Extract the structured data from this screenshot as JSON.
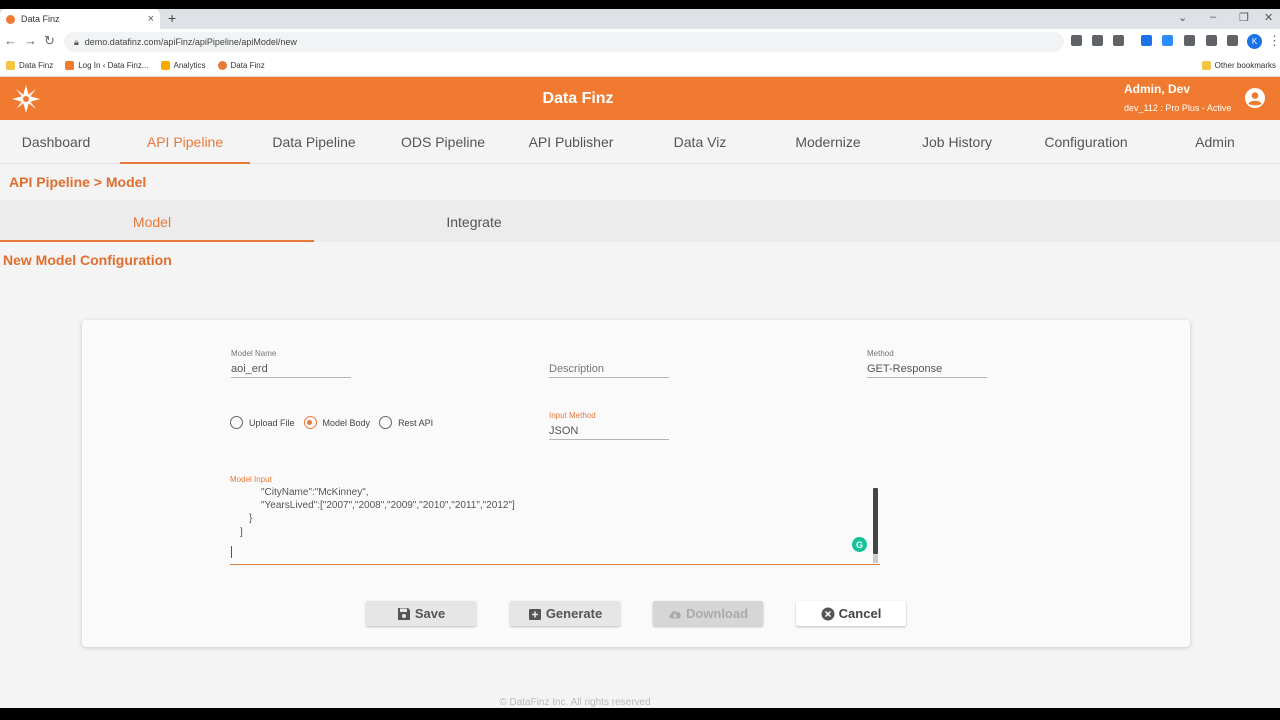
{
  "browser": {
    "tab_title": "Data Finz",
    "url": "demo.datafinz.com/apiFinz/apiPipeline/apiModel/new",
    "profile_initial": "K",
    "bookmarks": [
      {
        "label": "Data Finz",
        "color": "#f4c542"
      },
      {
        "label": "Log In ‹ Data Finz...",
        "color": "#f07a30"
      },
      {
        "label": "Analytics",
        "color": "#f9ab00"
      },
      {
        "label": "Data Finz",
        "color": "#e8793a"
      }
    ],
    "other_bookmarks": "Other bookmarks"
  },
  "header": {
    "title": "Data Finz",
    "user_name": "Admin, Dev",
    "user_role": "dev_112 : Pro Plus - Active",
    "brand_color": "#f07a30"
  },
  "nav": {
    "items": [
      "Dashboard",
      "API Pipeline",
      "Data Pipeline",
      "ODS Pipeline",
      "API Publisher",
      "Data Viz",
      "Modernize",
      "Job History",
      "Configuration",
      "Admin"
    ],
    "active": "API Pipeline"
  },
  "breadcrumb": "API Pipeline > Model",
  "subtabs": {
    "items": [
      "Model",
      "Integrate"
    ],
    "active": "Model"
  },
  "section_title": "New Model Configuration",
  "form": {
    "model_name_label": "Model Name",
    "model_name_value": "aoi_erd",
    "description_placeholder": "Description",
    "method_label": "Method",
    "method_value": "GET-Response",
    "input_method_label": "Input Method",
    "input_method_value": "JSON",
    "radios": [
      "Upload File",
      "Model Body",
      "Rest API"
    ],
    "selected_radio": "Model Body",
    "model_input_label": "Model Input",
    "code_lines": [
      "\"CityName\":\"McKinney\",",
      "\"YearsLived\":[\"2007\",\"2008\",\"2009\",\"2010\",\"2011\",\"2012\"]",
      "}",
      "]"
    ],
    "grammarly_letter": "G"
  },
  "buttons": {
    "save": "Save",
    "generate": "Generate",
    "download": "Download",
    "cancel": "Cancel"
  },
  "footer": "© DataFinz Inc. All rights reserved"
}
